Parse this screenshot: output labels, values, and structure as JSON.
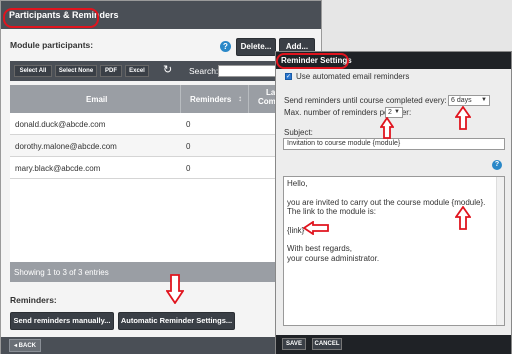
{
  "main_dialog": {
    "title": "Participants & Reminders",
    "module_participants_label": "Module participants:",
    "help_icon": "?",
    "delete_label": "Delete...",
    "add_label": "Add...",
    "toolbar": {
      "select_all": "Select All",
      "select_none": "Select None",
      "pdf": "PDF",
      "excel": "Excel",
      "refresh_icon": "↻",
      "search_label": "Search:",
      "search_value": ""
    },
    "table": {
      "headers": {
        "email": "Email",
        "reminders": "Reminders",
        "sort_icon": "↕",
        "last_line1": "La",
        "last_line2": "Comp"
      },
      "rows": [
        {
          "email": "donald.duck@abcde.com",
          "reminders": "0"
        },
        {
          "email": "dorothy.malone@abcde.com",
          "reminders": "0"
        },
        {
          "email": "mary.black@abcde.com",
          "reminders": "0"
        }
      ],
      "footer": "Showing 1 to 3 of 3 entries"
    },
    "reminders_label": "Reminders:",
    "send_manual_label": "Send reminders manually...",
    "auto_settings_label": "Automatic Reminder Settings...",
    "back_label": "◂ BACK"
  },
  "reminder_settings": {
    "title": "Reminder Settings",
    "use_auto_label": "Use automated email reminders",
    "use_auto_checked": true,
    "send_until_label": "Send reminders until course completed every:",
    "days_value": "6 days",
    "max_label": "Max. number of reminders per user:",
    "max_value": "2",
    "subject_label": "Subject:",
    "subject_value": "Invitation to course module {module}",
    "help_icon": "?",
    "body": {
      "line1": "Hello,",
      "line2": "you are invited to carry out the course module {module}.",
      "line3": "The link to the module is:",
      "line4": "{link}",
      "line5": "With best regards,",
      "line6": "your course administrator."
    },
    "save_label": "SAVE",
    "cancel_label": "CANCEL"
  },
  "colors": {
    "annotation_red": "#e0141e",
    "titlebar": "#4a4f56",
    "checkbox_blue": "#2a77d0"
  }
}
